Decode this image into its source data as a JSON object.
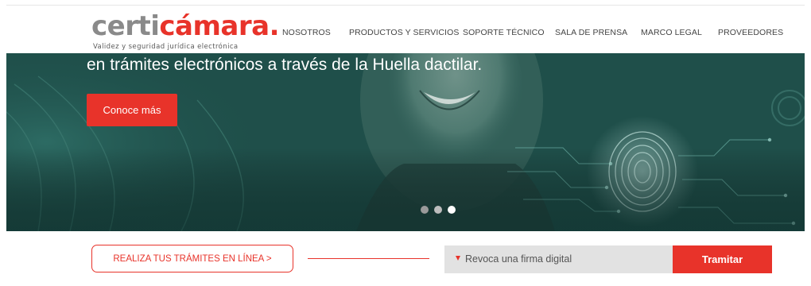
{
  "header": {
    "logo": {
      "part1": "certi",
      "part2": "cámara.",
      "tagline": "Validez y seguridad jurídica electrónica"
    },
    "nav": [
      {
        "label": "NOSOTROS"
      },
      {
        "label": "PRODUCTOS Y SERVICIOS"
      },
      {
        "label": "SOPORTE TÉCNICO"
      },
      {
        "label": "SALA DE PRENSA"
      },
      {
        "label": "MARCO LEGAL"
      },
      {
        "label": "PROVEEDORES"
      }
    ]
  },
  "hero": {
    "headline": "en trámites electrónicos a través de la Huella dactilar.",
    "cta_label": "Conoce más",
    "carousel": {
      "total": 3,
      "active": 3
    }
  },
  "actions": {
    "online_button": "REALIZA TUS TRÁMITES EN LÍNEA >",
    "select_value": "Revoca una firma digital",
    "submit_label": "Tramitar"
  },
  "colors": {
    "brand_red": "#e8332a",
    "logo_gray": "#8a8a8a",
    "hero_teal": "#1d4c47",
    "select_bg": "#e2e2e2"
  }
}
